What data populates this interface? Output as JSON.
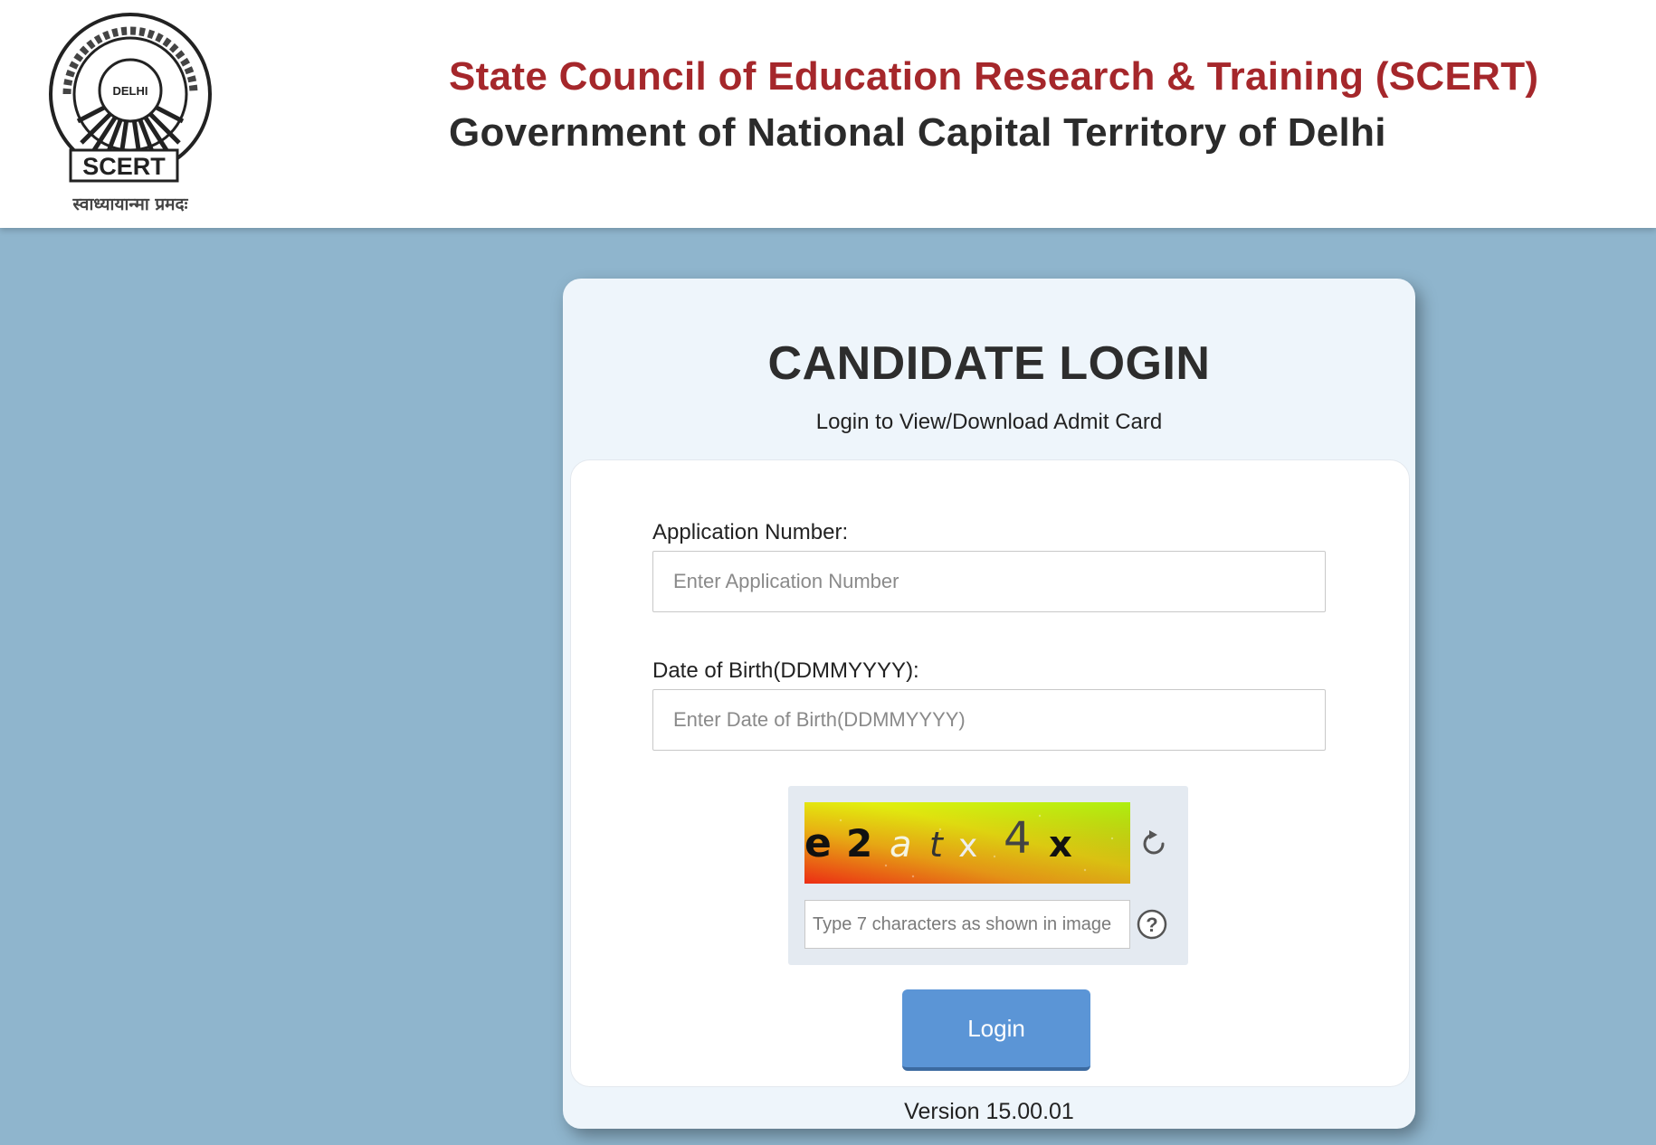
{
  "header": {
    "title": "State Council of Education Research & Training (SCERT)",
    "subtitle": "Government of National Capital Territory of Delhi",
    "logo": {
      "badge_text": "SCERT",
      "center_text": "DELHI",
      "motto": "स्वाध्यायान्मा प्रमदः"
    }
  },
  "login": {
    "title": "CANDIDATE LOGIN",
    "subtitle": "Login to View/Download Admit Card",
    "application_number": {
      "label": "Application Number:",
      "placeholder": "Enter Application Number",
      "value": ""
    },
    "dob": {
      "label": "Date of Birth(DDMMYYYY):",
      "placeholder": "Enter Date of Birth(DDMMYYYY)",
      "value": ""
    },
    "captcha": {
      "characters": [
        "e",
        "2",
        "a",
        "t",
        "x",
        "4",
        "x"
      ],
      "placeholder": "Type 7 characters as shown in image",
      "value": ""
    },
    "login_button": "Login",
    "version": "Version 15.00.01"
  },
  "colors": {
    "page_background": "#8fb5cd",
    "header_title": "#a5272b",
    "header_subtitle": "#2b2b2b",
    "button": "#5b95d6",
    "card": "#eef5fb"
  },
  "icons": {
    "refresh": "refresh-icon",
    "help": "help-icon"
  }
}
